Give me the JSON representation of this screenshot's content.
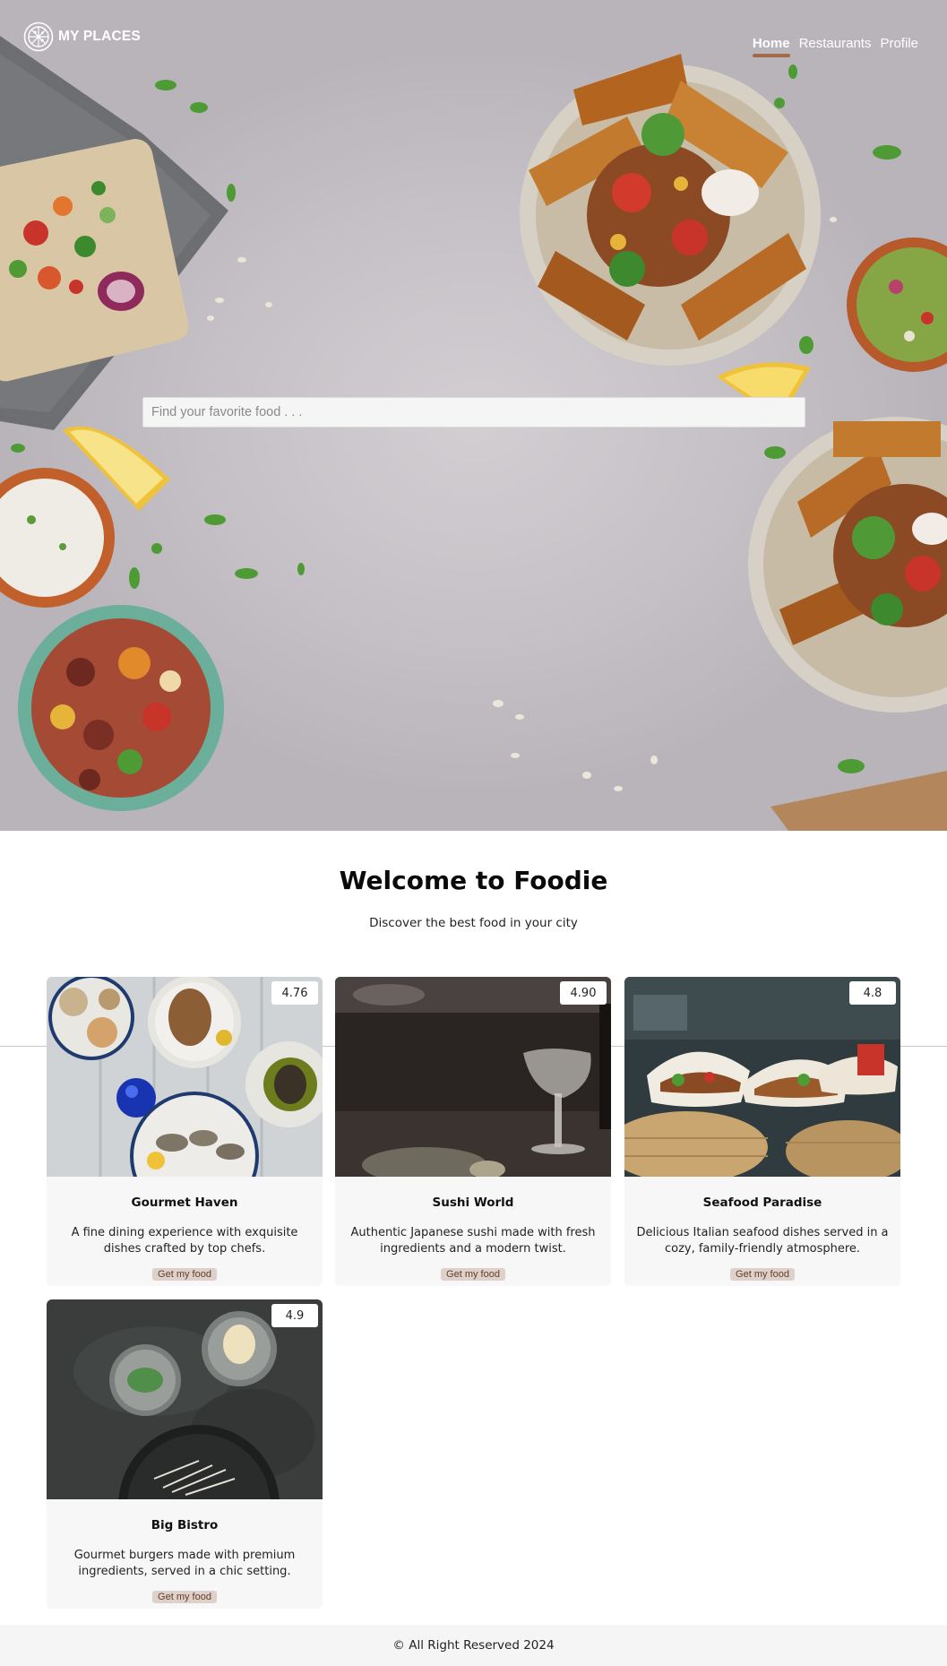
{
  "brand": {
    "name": "MY PLACES",
    "logo_icon": "pizza-icon"
  },
  "nav": {
    "items": [
      {
        "label": "Home",
        "active": true
      },
      {
        "label": "Restaurants",
        "active": false
      },
      {
        "label": "Profile",
        "active": false
      }
    ],
    "active_color": "#a26a46"
  },
  "search": {
    "placeholder": "Find your favorite food . . .",
    "value": ""
  },
  "welcome": {
    "title": "Welcome to Foodie",
    "subtitle": "Discover the best food in your city"
  },
  "restaurants": [
    {
      "name": "Gourmet Haven",
      "rating": "4.76",
      "description": "A fine dining experience with exquisite dishes crafted by top chefs.",
      "button": "Get my food"
    },
    {
      "name": "Sushi World",
      "rating": "4.90",
      "description": "Authentic Japanese sushi made with fresh ingredients and a modern twist.",
      "button": "Get my food"
    },
    {
      "name": "Seafood Paradise",
      "rating": "4.8",
      "description": "Delicious Italian seafood dishes served in a cozy, family-friendly atmosphere.",
      "button": "Get my food"
    },
    {
      "name": "Big Bistro",
      "rating": "4.9",
      "description": "Gourmet burgers made with premium ingredients, served in a chic setting.",
      "button": "Get my food"
    }
  ],
  "footer": {
    "text": "© All Right Reserved 2024"
  }
}
